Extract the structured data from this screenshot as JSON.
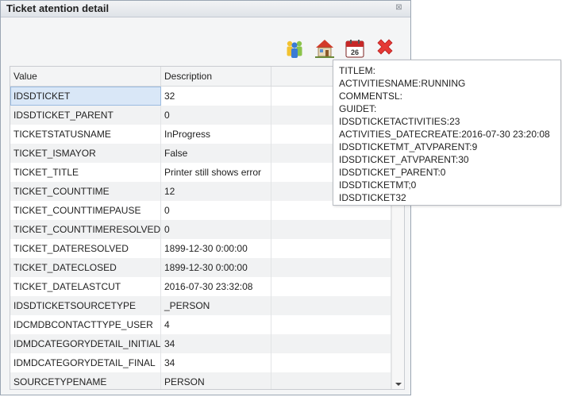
{
  "window": {
    "title": "Ticket atention detail",
    "close_glyph": "⊠"
  },
  "toolbar": {
    "buttons": [
      {
        "name": "users-icon"
      },
      {
        "name": "home-icon"
      },
      {
        "name": "calendar-icon",
        "text": "26"
      },
      {
        "name": "delete-icon"
      }
    ]
  },
  "grid": {
    "columns": [
      "Value",
      "Description",
      ""
    ],
    "rows": [
      {
        "value": "IDSDTICKET",
        "description": "32"
      },
      {
        "value": "IDSDTICKET_PARENT",
        "description": "0"
      },
      {
        "value": "TICKETSTATUSNAME",
        "description": "InProgress"
      },
      {
        "value": "TICKET_ISMAYOR",
        "description": "False"
      },
      {
        "value": "TICKET_TITLE",
        "description": "Printer still shows error"
      },
      {
        "value": "TICKET_COUNTTIME",
        "description": "12"
      },
      {
        "value": "TICKET_COUNTTIMEPAUSE",
        "description": "0"
      },
      {
        "value": "TICKET_COUNTTIMERESOLVED",
        "description": "0"
      },
      {
        "value": "TICKET_DATERESOLVED",
        "description": "1899-12-30 0:00:00"
      },
      {
        "value": "TICKET_DATECLOSED",
        "description": "1899-12-30 0:00:00"
      },
      {
        "value": "TICKET_DATELASTCUT",
        "description": "2016-07-30 23:32:08"
      },
      {
        "value": "IDSDTICKETSOURCETYPE",
        "description": "_PERSON"
      },
      {
        "value": "IDCMDBCONTACTTYPE_USER",
        "description": "4"
      },
      {
        "value": "IDMDCATEGORYDETAIL_INITIAL",
        "description": "34"
      },
      {
        "value": "IDMDCATEGORYDETAIL_FINAL",
        "description": "34"
      },
      {
        "value": "SOURCETYPENAME",
        "description": "PERSON"
      }
    ]
  },
  "tooltip": {
    "lines": [
      "TITLEM:",
      "ACTIVITIESNAME:RUNNING",
      "COMMENTSL:",
      "GUIDET:",
      "IDSDTICKETACTIVITIES:23",
      "ACTIVITIES_DATECREATE:2016-07-30 23:20:08",
      "IDSDTICKETMT_ATVPARENT:9",
      "IDSDTICKET_ATVPARENT:30",
      "IDSDTICKET_PARENT:0",
      "IDSDTICKETMT;0",
      "IDSDTICKET32"
    ]
  },
  "colors": {
    "delete": "#e53935",
    "calendar": "#c62828",
    "home_roof": "#d23a2a",
    "users": "#3a7bd5"
  }
}
